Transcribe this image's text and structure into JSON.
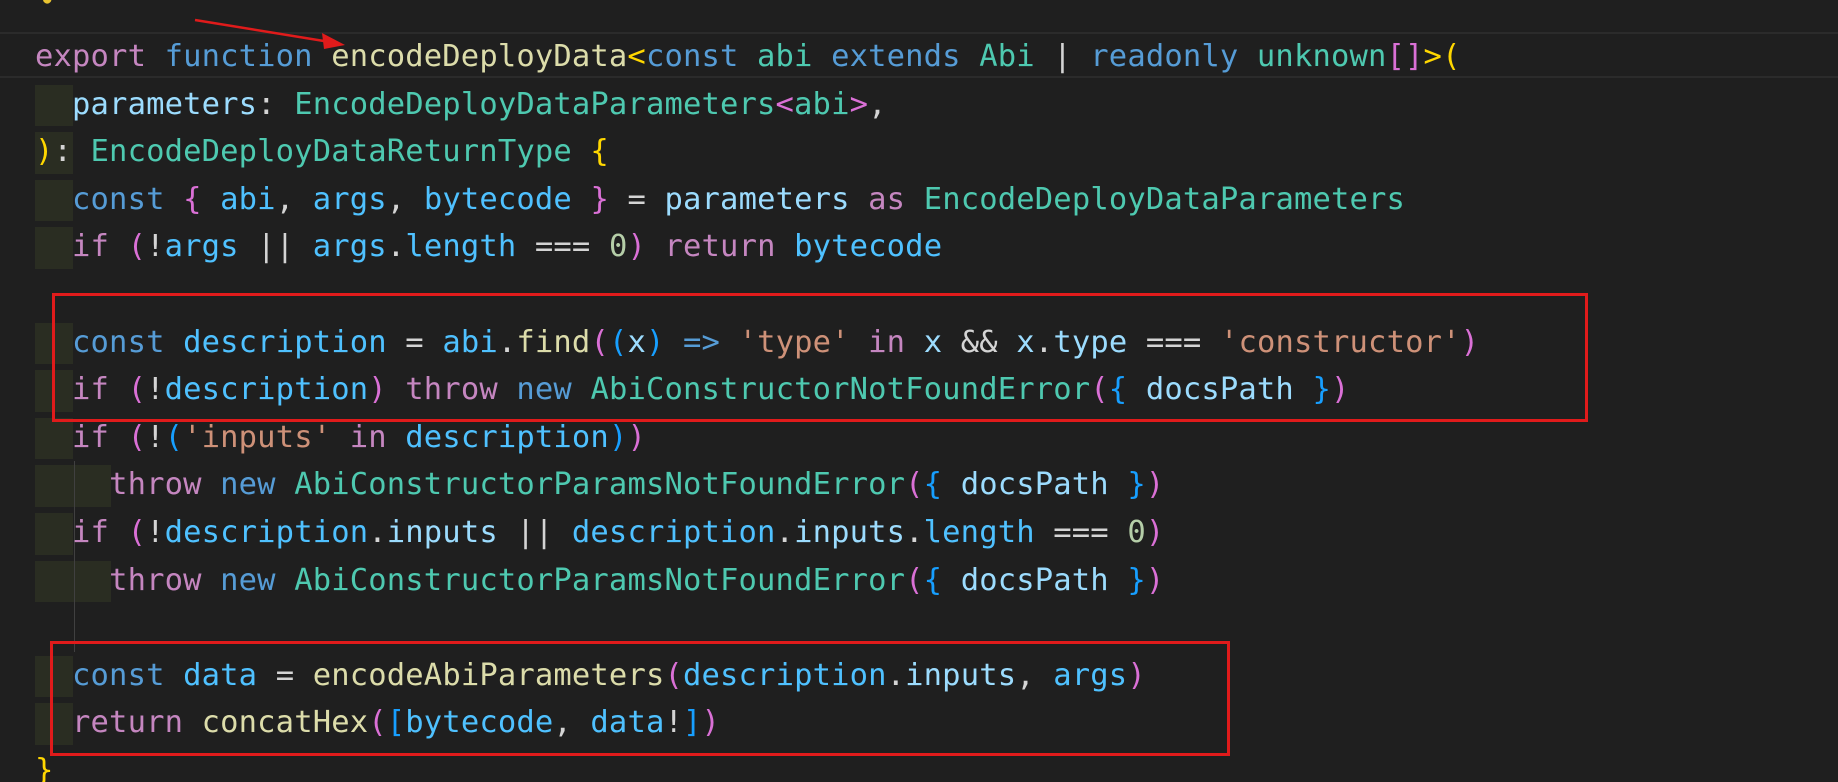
{
  "editor": {
    "theme_colors": {
      "background": "#1f1f1f",
      "keyword": "#c586c0",
      "storage": "#569cd6",
      "function": "#dcdcaa",
      "type": "#4ec9b0",
      "variable": "#9cdcfe",
      "property": "#9cdcfe",
      "constant": "#4fc1ff",
      "string": "#ce9178",
      "number": "#b5cea8",
      "operator": "#d4d4d4",
      "bracket_gold": "#ffd700",
      "bracket_pink": "#da70d6",
      "bracket_blue": "#179fff",
      "annotation_red": "#e01b1b"
    },
    "icons": {
      "lightbulb": "lightbulb-icon"
    },
    "lines": [
      [
        [
          "export",
          "keyword"
        ],
        [
          " ",
          "plain"
        ],
        [
          "function",
          "storage"
        ],
        [
          " ",
          "plain"
        ],
        [
          "encodeDeployData",
          "function"
        ],
        [
          "<",
          "bracket_gold"
        ],
        [
          "const",
          "storage"
        ],
        [
          " ",
          "plain"
        ],
        [
          "abi",
          "type"
        ],
        [
          " ",
          "plain"
        ],
        [
          "extends",
          "storage"
        ],
        [
          " ",
          "plain"
        ],
        [
          "Abi",
          "type"
        ],
        [
          " | ",
          "operator"
        ],
        [
          "readonly",
          "storage"
        ],
        [
          " ",
          "plain"
        ],
        [
          "unknown",
          "type"
        ],
        [
          "[]",
          "bracket_pink"
        ],
        [
          ">",
          "bracket_gold"
        ],
        [
          "(",
          "bracket_gold"
        ]
      ],
      [
        [
          "  ",
          "plain"
        ],
        [
          "parameters",
          "variable"
        ],
        [
          ": ",
          "operator"
        ],
        [
          "EncodeDeployDataParameters",
          "type"
        ],
        [
          "<",
          "bracket_pink"
        ],
        [
          "abi",
          "type"
        ],
        [
          ">",
          "bracket_pink"
        ],
        [
          ",",
          "operator"
        ]
      ],
      [
        [
          ")",
          "bracket_gold"
        ],
        [
          ": ",
          "operator"
        ],
        [
          "EncodeDeployDataReturnType",
          "type"
        ],
        [
          " ",
          "plain"
        ],
        [
          "{",
          "bracket_gold"
        ]
      ],
      [
        [
          "  ",
          "plain"
        ],
        [
          "const",
          "storage"
        ],
        [
          " ",
          "plain"
        ],
        [
          "{",
          "bracket_pink"
        ],
        [
          " ",
          "plain"
        ],
        [
          "abi",
          "constant"
        ],
        [
          ", ",
          "operator"
        ],
        [
          "args",
          "constant"
        ],
        [
          ", ",
          "operator"
        ],
        [
          "bytecode",
          "constant"
        ],
        [
          " ",
          "plain"
        ],
        [
          "}",
          "bracket_pink"
        ],
        [
          " = ",
          "operator"
        ],
        [
          "parameters",
          "variable"
        ],
        [
          " ",
          "plain"
        ],
        [
          "as",
          "keyword"
        ],
        [
          " ",
          "plain"
        ],
        [
          "EncodeDeployDataParameters",
          "type"
        ]
      ],
      [
        [
          "  ",
          "plain"
        ],
        [
          "if",
          "keyword"
        ],
        [
          " ",
          "plain"
        ],
        [
          "(",
          "bracket_pink"
        ],
        [
          "!",
          "operator"
        ],
        [
          "args",
          "constant"
        ],
        [
          " || ",
          "operator"
        ],
        [
          "args",
          "constant"
        ],
        [
          ".",
          "operator"
        ],
        [
          "length",
          "constant"
        ],
        [
          " === ",
          "operator"
        ],
        [
          "0",
          "number"
        ],
        [
          ")",
          "bracket_pink"
        ],
        [
          " ",
          "plain"
        ],
        [
          "return",
          "keyword"
        ],
        [
          " ",
          "plain"
        ],
        [
          "bytecode",
          "constant"
        ]
      ],
      [],
      [
        [
          "  ",
          "plain"
        ],
        [
          "const",
          "storage"
        ],
        [
          " ",
          "plain"
        ],
        [
          "description",
          "constant"
        ],
        [
          " = ",
          "operator"
        ],
        [
          "abi",
          "constant"
        ],
        [
          ".",
          "operator"
        ],
        [
          "find",
          "function"
        ],
        [
          "(",
          "bracket_pink"
        ],
        [
          "(",
          "bracket_blue"
        ],
        [
          "x",
          "variable"
        ],
        [
          ")",
          "bracket_blue"
        ],
        [
          " ",
          "plain"
        ],
        [
          "=>",
          "storage"
        ],
        [
          " ",
          "plain"
        ],
        [
          "'type'",
          "string"
        ],
        [
          " ",
          "plain"
        ],
        [
          "in",
          "keyword"
        ],
        [
          " ",
          "plain"
        ],
        [
          "x",
          "variable"
        ],
        [
          " && ",
          "operator"
        ],
        [
          "x",
          "variable"
        ],
        [
          ".",
          "operator"
        ],
        [
          "type",
          "property"
        ],
        [
          " === ",
          "operator"
        ],
        [
          "'constructor'",
          "string"
        ],
        [
          ")",
          "bracket_pink"
        ]
      ],
      [
        [
          "  ",
          "plain"
        ],
        [
          "if",
          "keyword"
        ],
        [
          " ",
          "plain"
        ],
        [
          "(",
          "bracket_pink"
        ],
        [
          "!",
          "operator"
        ],
        [
          "description",
          "constant"
        ],
        [
          ")",
          "bracket_pink"
        ],
        [
          " ",
          "plain"
        ],
        [
          "throw",
          "keyword"
        ],
        [
          " ",
          "plain"
        ],
        [
          "new",
          "storage"
        ],
        [
          " ",
          "plain"
        ],
        [
          "AbiConstructorNotFoundError",
          "type"
        ],
        [
          "(",
          "bracket_pink"
        ],
        [
          "{",
          "bracket_blue"
        ],
        [
          " ",
          "plain"
        ],
        [
          "docsPath",
          "variable"
        ],
        [
          " ",
          "plain"
        ],
        [
          "}",
          "bracket_blue"
        ],
        [
          ")",
          "bracket_pink"
        ]
      ],
      [
        [
          "  ",
          "plain"
        ],
        [
          "if",
          "keyword"
        ],
        [
          " ",
          "plain"
        ],
        [
          "(",
          "bracket_pink"
        ],
        [
          "!",
          "operator"
        ],
        [
          "(",
          "bracket_blue"
        ],
        [
          "'inputs'",
          "string"
        ],
        [
          " ",
          "plain"
        ],
        [
          "in",
          "keyword"
        ],
        [
          " ",
          "plain"
        ],
        [
          "description",
          "constant"
        ],
        [
          ")",
          "bracket_blue"
        ],
        [
          ")",
          "bracket_pink"
        ]
      ],
      [
        [
          "    ",
          "plain"
        ],
        [
          "throw",
          "keyword"
        ],
        [
          " ",
          "plain"
        ],
        [
          "new",
          "storage"
        ],
        [
          " ",
          "plain"
        ],
        [
          "AbiConstructorParamsNotFoundError",
          "type"
        ],
        [
          "(",
          "bracket_pink"
        ],
        [
          "{",
          "bracket_blue"
        ],
        [
          " ",
          "plain"
        ],
        [
          "docsPath",
          "variable"
        ],
        [
          " ",
          "plain"
        ],
        [
          "}",
          "bracket_blue"
        ],
        [
          ")",
          "bracket_pink"
        ]
      ],
      [
        [
          "  ",
          "plain"
        ],
        [
          "if",
          "keyword"
        ],
        [
          " ",
          "plain"
        ],
        [
          "(",
          "bracket_pink"
        ],
        [
          "!",
          "operator"
        ],
        [
          "description",
          "constant"
        ],
        [
          ".",
          "operator"
        ],
        [
          "inputs",
          "variable"
        ],
        [
          " || ",
          "operator"
        ],
        [
          "description",
          "constant"
        ],
        [
          ".",
          "operator"
        ],
        [
          "inputs",
          "variable"
        ],
        [
          ".",
          "operator"
        ],
        [
          "length",
          "constant"
        ],
        [
          " === ",
          "operator"
        ],
        [
          "0",
          "number"
        ],
        [
          ")",
          "bracket_pink"
        ]
      ],
      [
        [
          "    ",
          "plain"
        ],
        [
          "throw",
          "keyword"
        ],
        [
          " ",
          "plain"
        ],
        [
          "new",
          "storage"
        ],
        [
          " ",
          "plain"
        ],
        [
          "AbiConstructorParamsNotFoundError",
          "type"
        ],
        [
          "(",
          "bracket_pink"
        ],
        [
          "{",
          "bracket_blue"
        ],
        [
          " ",
          "plain"
        ],
        [
          "docsPath",
          "variable"
        ],
        [
          " ",
          "plain"
        ],
        [
          "}",
          "bracket_blue"
        ],
        [
          ")",
          "bracket_pink"
        ]
      ],
      [],
      [
        [
          "  ",
          "plain"
        ],
        [
          "const",
          "storage"
        ],
        [
          " ",
          "plain"
        ],
        [
          "data",
          "constant"
        ],
        [
          " = ",
          "operator"
        ],
        [
          "encodeAbiParameters",
          "function"
        ],
        [
          "(",
          "bracket_pink"
        ],
        [
          "description",
          "constant"
        ],
        [
          ".",
          "operator"
        ],
        [
          "inputs",
          "variable"
        ],
        [
          ", ",
          "operator"
        ],
        [
          "args",
          "constant"
        ],
        [
          ")",
          "bracket_pink"
        ]
      ],
      [
        [
          "  ",
          "plain"
        ],
        [
          "return",
          "keyword"
        ],
        [
          " ",
          "plain"
        ],
        [
          "concatHex",
          "function"
        ],
        [
          "(",
          "bracket_pink"
        ],
        [
          "[",
          "bracket_blue"
        ],
        [
          "bytecode",
          "constant"
        ],
        [
          ", ",
          "operator"
        ],
        [
          "data",
          "constant"
        ],
        [
          "!",
          "operator"
        ],
        [
          "]",
          "bracket_blue"
        ],
        [
          ")",
          "bracket_pink"
        ]
      ],
      [
        [
          "}",
          "bracket_gold"
        ]
      ]
    ]
  }
}
